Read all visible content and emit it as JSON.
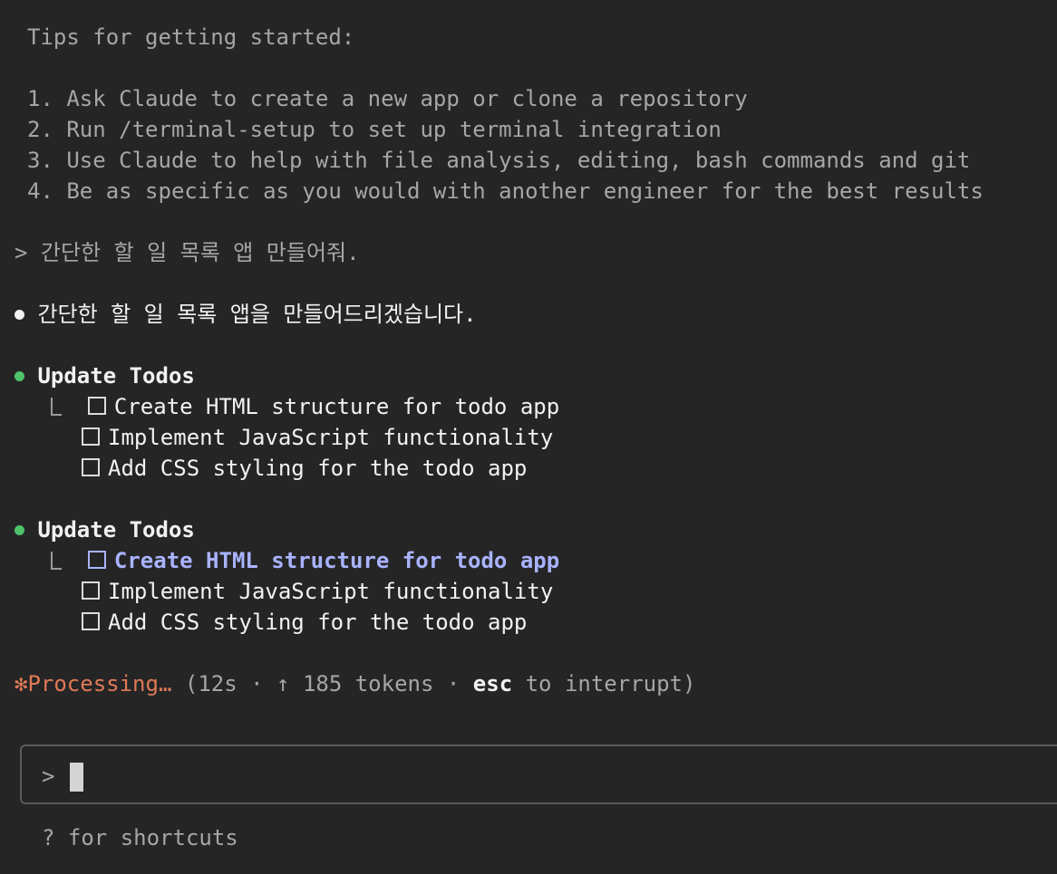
{
  "tips": {
    "heading": "Tips for getting started:",
    "items": [
      "1. Ask Claude to create a new app or clone a repository",
      "2. Run /terminal-setup to set up terminal integration",
      "3. Use Claude to help with file analysis, editing, bash commands and git",
      "4. Be as specific as you would with another engineer for the best results"
    ]
  },
  "user_message": {
    "prompt_symbol": ">",
    "text": "간단한 할 일 목록 앱 만들어줘."
  },
  "assistant_message": {
    "text": "간단한 할 일 목록 앱을 만들어드리겠습니다."
  },
  "todo_updates": [
    {
      "title": "Update Todos",
      "items": [
        {
          "label": "Create HTML structure for todo app",
          "active": false,
          "checked": false
        },
        {
          "label": "Implement JavaScript functionality",
          "active": false,
          "checked": false
        },
        {
          "label": "Add CSS styling for the todo app",
          "active": false,
          "checked": false
        }
      ]
    },
    {
      "title": "Update Todos",
      "items": [
        {
          "label": "Create HTML structure for todo app",
          "active": true,
          "checked": false
        },
        {
          "label": "Implement JavaScript functionality",
          "active": false,
          "checked": false
        },
        {
          "label": "Add CSS styling for the todo app",
          "active": false,
          "checked": false
        }
      ]
    }
  ],
  "status": {
    "icon": "✻",
    "label": "Processing…",
    "open_paren": "(",
    "elapsed": "12s",
    "sep1": "·",
    "arrow": "↑",
    "tokens": "185 tokens",
    "sep2": "·",
    "key": "esc",
    "key_suffix": "to interrupt)"
  },
  "input": {
    "prompt_symbol": ">",
    "value": ""
  },
  "footer": {
    "hint": "? for shortcuts"
  },
  "colors": {
    "background": "#252526",
    "success_green": "#4ec36b",
    "active_blue": "#a9b3ff",
    "processing_orange": "#e07a55"
  }
}
